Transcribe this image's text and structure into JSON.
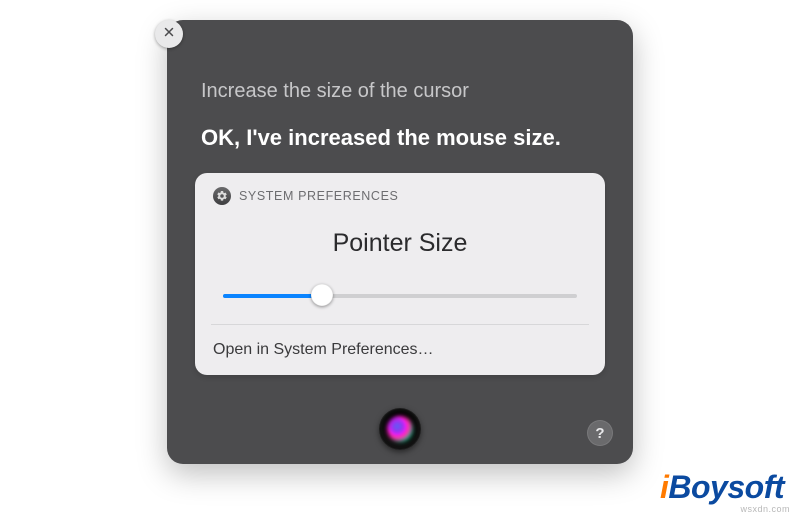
{
  "siri": {
    "query": "Increase the size of the cursor",
    "response": "OK, I've increased the mouse size.",
    "help_label": "?"
  },
  "card": {
    "source": "SYSTEM PREFERENCES",
    "title": "Pointer Size",
    "slider_percent": 28,
    "open_link": "Open in System Preferences…"
  },
  "branding": {
    "name": "iBoysoft",
    "site": "wsxdn.com"
  }
}
